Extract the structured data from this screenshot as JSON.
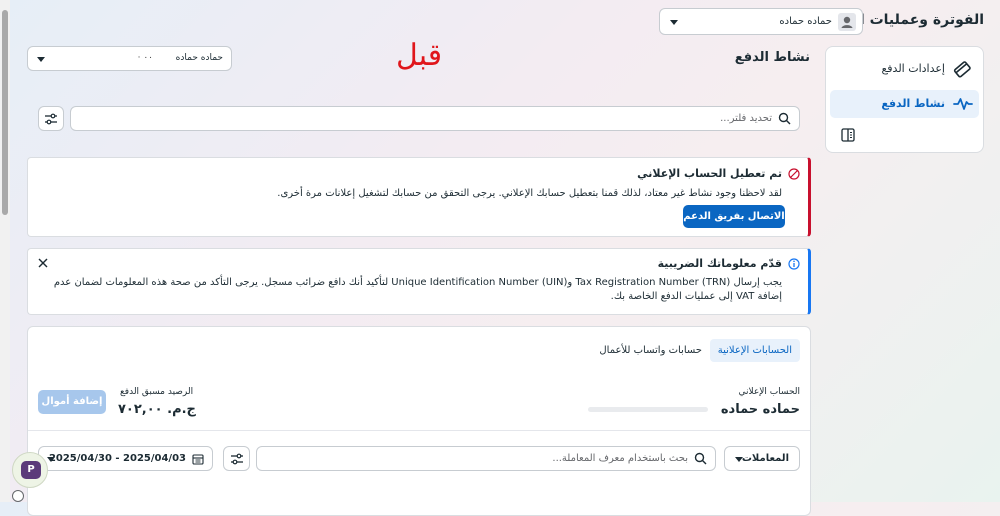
{
  "header": {
    "title": "الفوترة وعمليات الدفع",
    "account_selector": {
      "value": "حماده حماده"
    }
  },
  "sidebar": {
    "items": [
      {
        "label": "إعدادات الدفع",
        "icon": "credit-card-icon"
      },
      {
        "label": "نشاط الدفع",
        "icon": "activity-icon"
      },
      {
        "label": "",
        "icon": "panel-toggle-icon"
      }
    ]
  },
  "page": {
    "title": "نشاط الدفع",
    "annotation": "قبل",
    "account_dropdown": {
      "value": "حماده حماده",
      "masked_id": "٠٠ ·"
    }
  },
  "filter": {
    "placeholder": "تحديد فلتر..."
  },
  "alerts": {
    "disabled": {
      "title": "تم تعطيل الحساب الإعلاني",
      "body": "لقد لاحظنا وجود نشاط غير معتاد، لذلك قمنا بتعطيل حسابك الإعلاني. يرجى التحقق من حسابك لتشغيل إعلانات مرة أخرى.",
      "button": "الاتصال بفريق الدعم"
    },
    "tax": {
      "title": "قدّم معلوماتك الضريبية",
      "body": "يجب إرسال Tax Registration Number (TRN) وUnique Identification Number (UIN) لتأكيد أنك دافع ضرائب مسجل. يرجى التأكد من صحة هذه المعلومات لضمان عدم إضافة VAT إلى عمليات الدفع الخاصة بك."
    }
  },
  "accounts": {
    "tabs": [
      "الحسابات الإعلانية",
      "حسابات واتساب للأعمال"
    ],
    "ad_account_label": "الحساب الإعلاني",
    "ad_account_name": "حماده حماده",
    "prepaid_label": "الرصيد مسبق الدفع",
    "prepaid_value": "ج.م. ٧٠٢,٠٠",
    "add_funds": "إضافة أموال"
  },
  "transactions": {
    "type": "المعاملات",
    "search_placeholder": "بحث باستخدام معرف المعاملة...",
    "date_range": "2025/04/03 - 2025/04/30"
  },
  "colors": {
    "primary": "#0a66c2",
    "danger": "#c8102e",
    "annotation": "#e0161b",
    "info": "#1877f2",
    "selected_bg": "#e8f1fb"
  }
}
